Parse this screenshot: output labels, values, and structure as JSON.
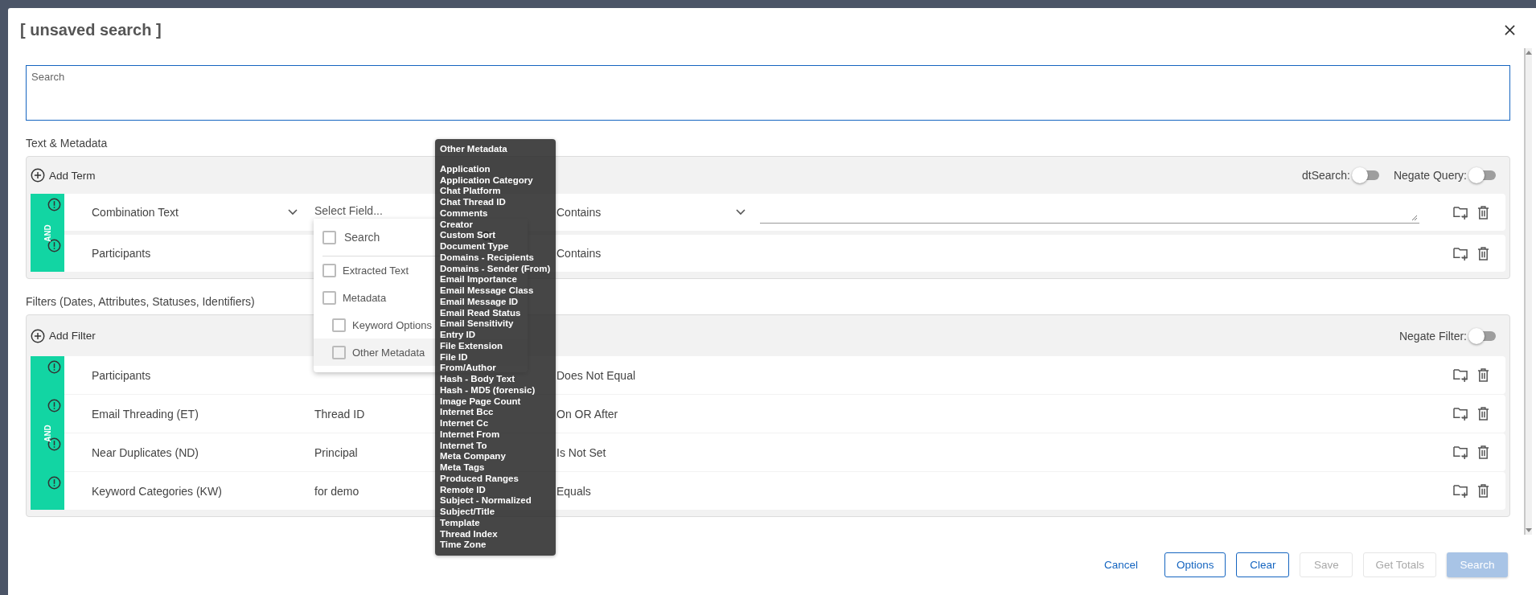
{
  "dialog": {
    "title": "[ unsaved search ]"
  },
  "search_box": {
    "placeholder": "Search"
  },
  "text_metadata": {
    "heading": "Text & Metadata",
    "add_label": "Add Term",
    "connector": "AND",
    "toggles": [
      {
        "label": "dtSearch:",
        "on": false
      },
      {
        "label": "Negate Query:",
        "on": false
      }
    ],
    "rows": [
      {
        "kind": "editing",
        "type": "Combination Text",
        "field_placeholder": "Select Field...",
        "operator": "Contains"
      },
      {
        "kind": "summary",
        "type": "Participants",
        "operator": "Contains"
      }
    ]
  },
  "filters": {
    "heading": "Filters (Dates, Attributes, Statuses, Identifiers)",
    "add_label": "Add Filter",
    "connector": "AND",
    "toggles": [
      {
        "label": "Negate Filter:",
        "on": false
      }
    ],
    "rows": [
      {
        "type": "Participants",
        "operator": "Does Not Equal"
      },
      {
        "type": "Email Threading (ET)",
        "field": "Thread ID",
        "operator": "On OR After"
      },
      {
        "type": "Near Duplicates (ND)",
        "field": "Principal",
        "operator": "Is Not Set"
      },
      {
        "type": "Keyword Categories (KW)",
        "field": "for demo",
        "operator": "Equals"
      }
    ]
  },
  "field_dropdown": {
    "search": {
      "placeholder": "Search",
      "checked": false
    },
    "items": [
      {
        "label": "Extracted Text",
        "checked": false,
        "selected": false
      },
      {
        "label": "Metadata",
        "checked": false,
        "selected": false,
        "children": [
          {
            "label": "Keyword Options",
            "checked": false,
            "selected": false
          },
          {
            "label": "Other Metadata",
            "checked": false,
            "selected": true
          }
        ]
      }
    ]
  },
  "tooltip": {
    "title": "Other Metadata",
    "items": [
      "Application",
      "Application Category",
      "Chat Platform",
      "Chat Thread ID",
      "Comments",
      "Creator",
      "Custom Sort",
      "Document Type",
      "Domains - Recipients",
      "Domains - Sender (From)",
      "Email Importance",
      "Email Message Class",
      "Email Message ID",
      "Email Read Status",
      "Email Sensitivity",
      "Entry ID",
      "File Extension",
      "File ID",
      "From/Author",
      "Hash - Body Text",
      "Hash - MD5 (forensic)",
      "Image Page Count",
      "Internet Bcc",
      "Internet Cc",
      "Internet From",
      "Internet To",
      "Meta Company",
      "Meta Tags",
      "Produced Ranges",
      "Remote ID",
      "Subject - Normalized",
      "Subject/Title",
      "Template",
      "Thread Index",
      "Time Zone"
    ]
  },
  "buttons": [
    {
      "label": "Cancel",
      "kind": "link",
      "disabled": false
    },
    {
      "label": "Options",
      "kind": "outline",
      "disabled": false
    },
    {
      "label": "Clear",
      "kind": "outline",
      "disabled": false
    },
    {
      "label": "Save",
      "kind": "outline",
      "disabled": true
    },
    {
      "label": "Get Totals",
      "kind": "outline",
      "disabled": true
    },
    {
      "label": "Search",
      "kind": "primary",
      "disabled": true
    }
  ]
}
